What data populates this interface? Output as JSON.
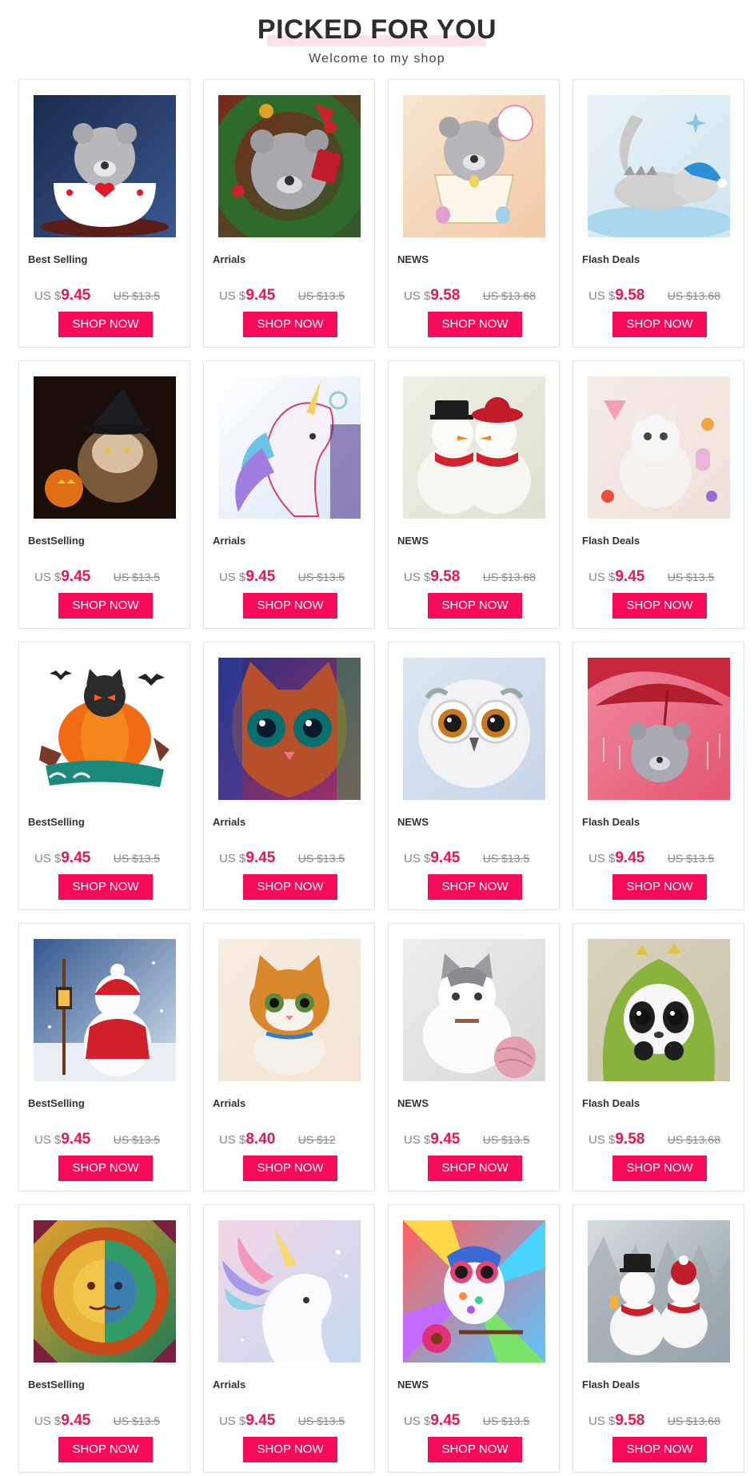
{
  "header": {
    "title": "PICKED FOR YOU",
    "subtitle": "Welcome to my shop"
  },
  "currency_prefix": "US $",
  "button_label": "SHOP NOW",
  "products": [
    {
      "label": "Best Selling",
      "price": "9.45",
      "old_price": "US $13.5",
      "image": "teddy bear in teacup"
    },
    {
      "label": "Arrials",
      "price": "9.45",
      "old_price": "US $13.5",
      "image": "teddy bear in christmas wreath"
    },
    {
      "label": "NEWS",
      "price": "9.58",
      "old_price": "US $13.68",
      "image": "teddy bear in flower basket"
    },
    {
      "label": "Flash Deals",
      "price": "9.58",
      "old_price": "US $13.68",
      "image": "sleeping baby dinosaur on moon"
    },
    {
      "label": "BestSelling",
      "price": "9.45",
      "old_price": "US $13.5",
      "image": "witch cat with pumpkin"
    },
    {
      "label": "Arrials",
      "price": "9.45",
      "old_price": "US $13.5",
      "image": "colorful unicorn"
    },
    {
      "label": "NEWS",
      "price": "9.58",
      "old_price": "US $13.68",
      "image": "snowman couple"
    },
    {
      "label": "Flash Deals",
      "price": "9.45",
      "old_price": "US $13.5",
      "image": "white kitten with sweets"
    },
    {
      "label": "BestSelling",
      "price": "9.45",
      "old_price": "US $13.5",
      "image": "halloween black cat on pumpkin"
    },
    {
      "label": "Arrials",
      "price": "9.45",
      "old_price": "US $13.5",
      "image": "colorful big-eyed cat"
    },
    {
      "label": "NEWS",
      "price": "9.45",
      "old_price": "US $13.5",
      "image": "white owl"
    },
    {
      "label": "Flash Deals",
      "price": "9.45",
      "old_price": "US $13.5",
      "image": "teddy bear with red umbrella"
    },
    {
      "label": "BestSelling",
      "price": "9.45",
      "old_price": "US $13.5",
      "image": "snowman with lantern"
    },
    {
      "label": "Arrials",
      "price": "8.40",
      "old_price": "US $12",
      "image": "orange kitten"
    },
    {
      "label": "NEWS",
      "price": "9.45",
      "old_price": "US $13.5",
      "image": "white kitten with yarn"
    },
    {
      "label": "Flash Deals",
      "price": "9.58",
      "old_price": "US $13.68",
      "image": "panda in dinosaur costume"
    },
    {
      "label": "BestSelling",
      "price": "9.45",
      "old_price": "US $13.5",
      "image": "sun and moon mandala"
    },
    {
      "label": "Arrials",
      "price": "9.45",
      "old_price": "US $13.5",
      "image": "rainbow unicorn"
    },
    {
      "label": "NEWS",
      "price": "9.45",
      "old_price": "US $13.5",
      "image": "rainbow owl with flowers"
    },
    {
      "label": "Flash Deals",
      "price": "9.58",
      "old_price": "US $13.68",
      "image": "snowmen in snow forest"
    }
  ]
}
